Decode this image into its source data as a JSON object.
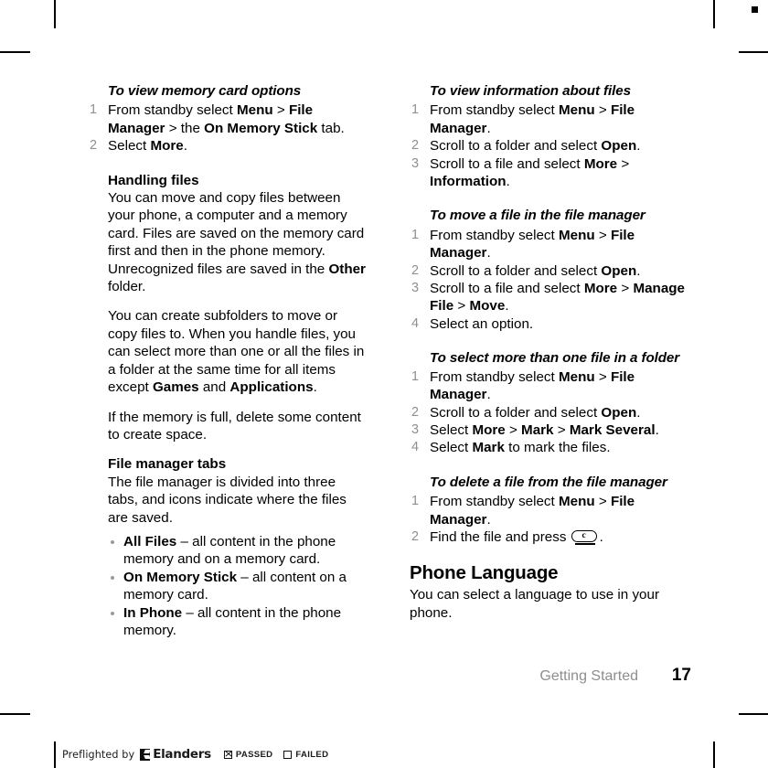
{
  "document": {
    "footer": {
      "chapter": "Getting Started",
      "page_number": "17"
    },
    "preflight": {
      "label": "Preflighted by",
      "brand": "Elanders",
      "passed_label": "PASSED",
      "failed_label": "FAILED"
    }
  },
  "left_column": {
    "proc1": {
      "title": "To view memory card options",
      "steps": [
        {
          "num": "1",
          "parts": [
            {
              "t": "From standby select ",
              "b": false
            },
            {
              "t": "Menu",
              "b": true
            },
            {
              "t": " > ",
              "b": false
            },
            {
              "t": "File Manager",
              "b": true
            },
            {
              "t": " > the ",
              "b": false
            },
            {
              "t": "On Memory Stick",
              "b": true
            },
            {
              "t": " tab.",
              "b": false
            }
          ]
        },
        {
          "num": "2",
          "parts": [
            {
              "t": "Select ",
              "b": false
            },
            {
              "t": "More",
              "b": true
            },
            {
              "t": ".",
              "b": false
            }
          ]
        }
      ]
    },
    "handling_files": {
      "heading": "Handling files",
      "para1": [
        {
          "t": "You can move and copy files between your phone, a computer and a memory card. Files are saved on the memory card first and then in the phone memory. Unrecognized files are saved in the ",
          "b": false
        },
        {
          "t": "Other",
          "b": true
        },
        {
          "t": " folder.",
          "b": false
        }
      ],
      "para2": [
        {
          "t": "You can create subfolders to move or copy files to. When you handle files, you can select more than one or all the files in a folder at the same time for all items except ",
          "b": false
        },
        {
          "t": "Games",
          "b": true
        },
        {
          "t": " and ",
          "b": false
        },
        {
          "t": "Applications",
          "b": true
        },
        {
          "t": ".",
          "b": false
        }
      ],
      "para3": [
        {
          "t": "If the memory is full, delete some content to create space.",
          "b": false
        }
      ]
    },
    "file_manager_tabs": {
      "heading": "File manager tabs",
      "para": [
        {
          "t": "The file manager is divided into three tabs, and icons indicate where the files are saved.",
          "b": false
        }
      ],
      "bullets": [
        [
          {
            "t": "All Files",
            "b": true
          },
          {
            "t": " – all content in the phone memory and on a memory card.",
            "b": false
          }
        ],
        [
          {
            "t": "On Memory Stick",
            "b": true
          },
          {
            "t": " – all content on a memory card.",
            "b": false
          }
        ],
        [
          {
            "t": "In Phone",
            "b": true
          },
          {
            "t": " – all content in the phone memory.",
            "b": false
          }
        ]
      ]
    }
  },
  "right_column": {
    "proc_info": {
      "title": "To view information about files",
      "steps": [
        {
          "num": "1",
          "parts": [
            {
              "t": "From standby select ",
              "b": false
            },
            {
              "t": "Menu",
              "b": true
            },
            {
              "t": " > ",
              "b": false
            },
            {
              "t": "File Manager",
              "b": true
            },
            {
              "t": ".",
              "b": false
            }
          ]
        },
        {
          "num": "2",
          "parts": [
            {
              "t": "Scroll to a folder and select ",
              "b": false
            },
            {
              "t": "Open",
              "b": true
            },
            {
              "t": ".",
              "b": false
            }
          ]
        },
        {
          "num": "3",
          "parts": [
            {
              "t": "Scroll to a file and select ",
              "b": false
            },
            {
              "t": "More",
              "b": true
            },
            {
              "t": " > ",
              "b": false
            },
            {
              "t": "Information",
              "b": true
            },
            {
              "t": ".",
              "b": false
            }
          ]
        }
      ]
    },
    "proc_move": {
      "title": "To move a file in the file manager",
      "steps": [
        {
          "num": "1",
          "parts": [
            {
              "t": "From standby select ",
              "b": false
            },
            {
              "t": "Menu",
              "b": true
            },
            {
              "t": " > ",
              "b": false
            },
            {
              "t": "File Manager",
              "b": true
            },
            {
              "t": ".",
              "b": false
            }
          ]
        },
        {
          "num": "2",
          "parts": [
            {
              "t": "Scroll to a folder and select ",
              "b": false
            },
            {
              "t": "Open",
              "b": true
            },
            {
              "t": ".",
              "b": false
            }
          ]
        },
        {
          "num": "3",
          "parts": [
            {
              "t": "Scroll to a file and select ",
              "b": false
            },
            {
              "t": "More",
              "b": true
            },
            {
              "t": " > ",
              "b": false
            },
            {
              "t": "Manage File",
              "b": true
            },
            {
              "t": " > ",
              "b": false
            },
            {
              "t": "Move",
              "b": true
            },
            {
              "t": ".",
              "b": false
            }
          ]
        },
        {
          "num": "4",
          "parts": [
            {
              "t": "Select an option.",
              "b": false
            }
          ]
        }
      ]
    },
    "proc_select": {
      "title": "To select more than one file in a folder",
      "steps": [
        {
          "num": "1",
          "parts": [
            {
              "t": "From standby select ",
              "b": false
            },
            {
              "t": "Menu",
              "b": true
            },
            {
              "t": " > ",
              "b": false
            },
            {
              "t": "File Manager",
              "b": true
            },
            {
              "t": ".",
              "b": false
            }
          ]
        },
        {
          "num": "2",
          "parts": [
            {
              "t": "Scroll to a folder and select ",
              "b": false
            },
            {
              "t": "Open",
              "b": true
            },
            {
              "t": ".",
              "b": false
            }
          ]
        },
        {
          "num": "3",
          "parts": [
            {
              "t": "Select ",
              "b": false
            },
            {
              "t": "More",
              "b": true
            },
            {
              "t": " > ",
              "b": false
            },
            {
              "t": "Mark",
              "b": true
            },
            {
              "t": " > ",
              "b": false
            },
            {
              "t": "Mark Several",
              "b": true
            },
            {
              "t": ".",
              "b": false
            }
          ]
        },
        {
          "num": "4",
          "parts": [
            {
              "t": "Select ",
              "b": false
            },
            {
              "t": "Mark",
              "b": true
            },
            {
              "t": " to mark the files.",
              "b": false
            }
          ]
        }
      ]
    },
    "proc_delete": {
      "title": "To delete a file from the file manager",
      "steps": [
        {
          "num": "1",
          "parts": [
            {
              "t": "From standby select ",
              "b": false
            },
            {
              "t": "Menu",
              "b": true
            },
            {
              "t": " > ",
              "b": false
            },
            {
              "t": "File Manager",
              "b": true
            },
            {
              "t": ".",
              "b": false
            }
          ]
        },
        {
          "num": "2",
          "parts": [
            {
              "t": "Find the file and press ",
              "b": false
            },
            {
              "t": "@CKEY@",
              "b": false
            },
            {
              "t": ".",
              "b": false
            }
          ]
        }
      ],
      "clear_key_label": "c"
    },
    "phone_language": {
      "heading": "Phone Language",
      "para": [
        {
          "t": "You can select a language to use in your phone.",
          "b": false
        }
      ]
    }
  }
}
